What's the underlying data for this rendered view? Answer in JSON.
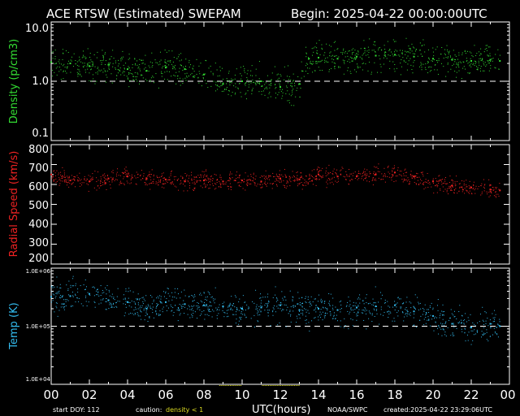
{
  "header": {
    "title": "ACE RTSW (Estimated) SWEPAM",
    "begin": "Begin: 2025-04-22 00:00:00UTC"
  },
  "footer": {
    "start_doy": "start DOY: 112",
    "caution_label": "caution:",
    "caution_value": "density < 1",
    "xlabel": "UTC(hours)",
    "source": "NOAA/SWPC",
    "created": "created:2025-04-22 23:29:06UTC"
  },
  "colors": {
    "density": "#33dd33",
    "speed": "#ee2222",
    "temp": "#33bbee",
    "caution": "#dddd22",
    "axis": "#ffffff"
  },
  "chart_data": [
    {
      "type": "scatter",
      "ylabel": "Density (p/cm3)",
      "yscale": "log",
      "ylim": [
        0.1,
        10.0
      ],
      "yticks": [
        "10.0",
        "1.0",
        "0.1"
      ],
      "reference_line": 1.0,
      "xlim": [
        0,
        24
      ],
      "series": [
        {
          "x": [
            0,
            1,
            2,
            3,
            4,
            5,
            6,
            7,
            8,
            9,
            10,
            11,
            12,
            13,
            13.5,
            14,
            15,
            16,
            17,
            18,
            19,
            20,
            21,
            22,
            23,
            23.5
          ],
          "values": [
            2.1,
            2.0,
            1.8,
            1.9,
            1.6,
            1.5,
            1.7,
            1.6,
            1.3,
            0.9,
            1.0,
            1.0,
            0.8,
            0.9,
            2.4,
            2.5,
            2.4,
            2.6,
            2.7,
            2.8,
            2.6,
            2.4,
            2.3,
            2.2,
            2.3,
            2.2
          ]
        }
      ]
    },
    {
      "type": "scatter",
      "ylabel": "Radial Speed (km/s)",
      "ylim": [
        200,
        800
      ],
      "yticks": [
        "800",
        "700",
        "600",
        "500",
        "400",
        "300",
        "200"
      ],
      "xlim": [
        0,
        24
      ],
      "series": [
        {
          "x": [
            0,
            1,
            2,
            3,
            4,
            5,
            6,
            7,
            8,
            9,
            10,
            11,
            12,
            13,
            14,
            15,
            16,
            17,
            18,
            19,
            20,
            21,
            22,
            23,
            23.5
          ],
          "values": [
            650,
            620,
            615,
            630,
            640,
            630,
            625,
            615,
            620,
            615,
            620,
            615,
            630,
            625,
            650,
            640,
            640,
            650,
            660,
            640,
            615,
            595,
            585,
            575,
            570
          ]
        }
      ]
    },
    {
      "type": "scatter",
      "ylabel": "Temp (K)",
      "yscale": "log",
      "ylim": [
        10000,
        1000000
      ],
      "yticks": [
        "1.0E+06",
        "1.0E+05",
        "1.0E+04"
      ],
      "reference_line": 100000,
      "xlim": [
        0,
        24
      ],
      "xticks": [
        "00",
        "02",
        "04",
        "06",
        "08",
        "10",
        "12",
        "14",
        "16",
        "18",
        "20",
        "22",
        "00"
      ],
      "series": [
        {
          "x": [
            0,
            1,
            2,
            3,
            4,
            5,
            6,
            7,
            8,
            9,
            10,
            11,
            12,
            13,
            14,
            15,
            16,
            17,
            18,
            19,
            20,
            21,
            22,
            23,
            23.5
          ],
          "values": [
            320000,
            330000,
            360000,
            280000,
            260000,
            200000,
            260000,
            240000,
            230000,
            220000,
            200000,
            210000,
            230000,
            190000,
            200000,
            190000,
            210000,
            220000,
            230000,
            180000,
            150000,
            110000,
            95000,
            110000,
            100000
          ]
        }
      ]
    }
  ]
}
